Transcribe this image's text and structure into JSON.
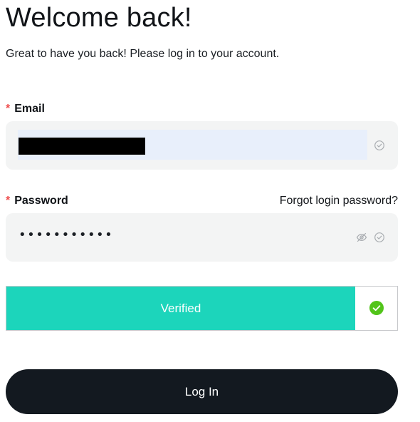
{
  "header": {
    "title": "Welcome back!",
    "subtitle": "Great to have you back! Please log in to your account."
  },
  "form": {
    "required_marker": "*",
    "email": {
      "label": "Email",
      "value": ""
    },
    "password": {
      "label": "Password",
      "forgot_link": "Forgot login password?",
      "value": "•••••••••••"
    },
    "captcha": {
      "status": "Verified",
      "color": "#1cd5bb",
      "check_color": "#52c41a"
    },
    "submit": {
      "label": "Log In",
      "color": "#131920"
    }
  },
  "colors": {
    "required": "#ee4b4b",
    "field_bg": "#f3f4f4",
    "autofill_bg": "#e8effb"
  }
}
